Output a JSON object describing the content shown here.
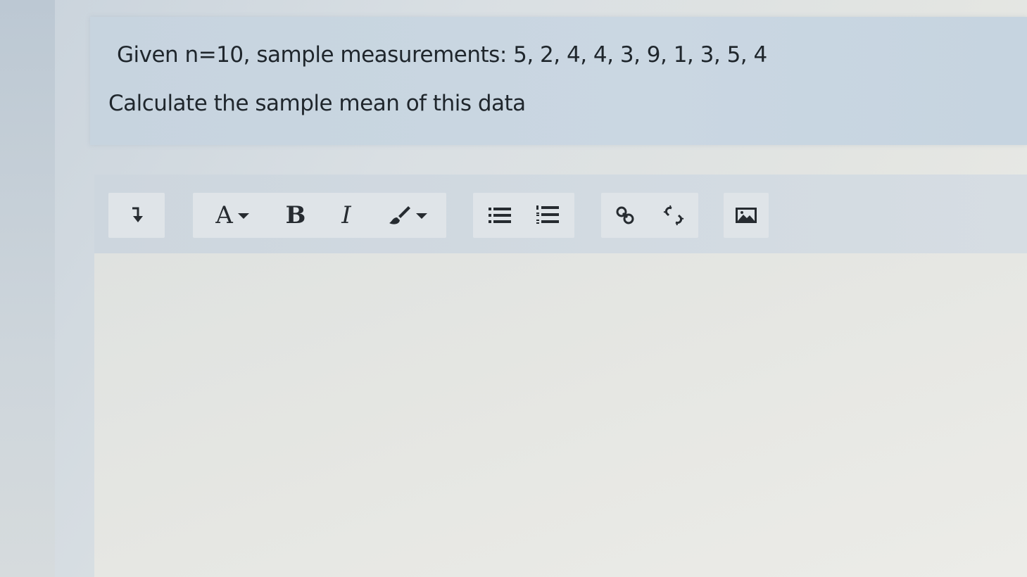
{
  "question": {
    "line1": "Given n=10, sample measurements: 5, 2, 4, 4, 3, 9, 1, 3, 5, 4",
    "line2": "Calculate the sample mean of this data"
  },
  "toolbar": {
    "buttons": [
      {
        "name": "paragraph-format",
        "icon": "arrow-down-icon"
      },
      {
        "name": "font-size",
        "label": "A",
        "icon": "caret-down-icon"
      },
      {
        "name": "bold",
        "label": "B"
      },
      {
        "name": "italic",
        "label": "I"
      },
      {
        "name": "text-color",
        "icon": "brush-icon"
      },
      {
        "name": "unordered-list",
        "icon": "bullet-list-icon"
      },
      {
        "name": "ordered-list",
        "icon": "numbered-list-icon"
      },
      {
        "name": "insert-link",
        "icon": "link-icon"
      },
      {
        "name": "remove-link",
        "icon": "unlink-icon"
      },
      {
        "name": "insert-image",
        "icon": "image-icon"
      }
    ]
  },
  "editor": {
    "content": ""
  },
  "colors": {
    "panel": "#c9d6e1",
    "toolbar": "#d3dbe2",
    "button_bg": "#dfe4e8",
    "text": "#1f262c"
  }
}
